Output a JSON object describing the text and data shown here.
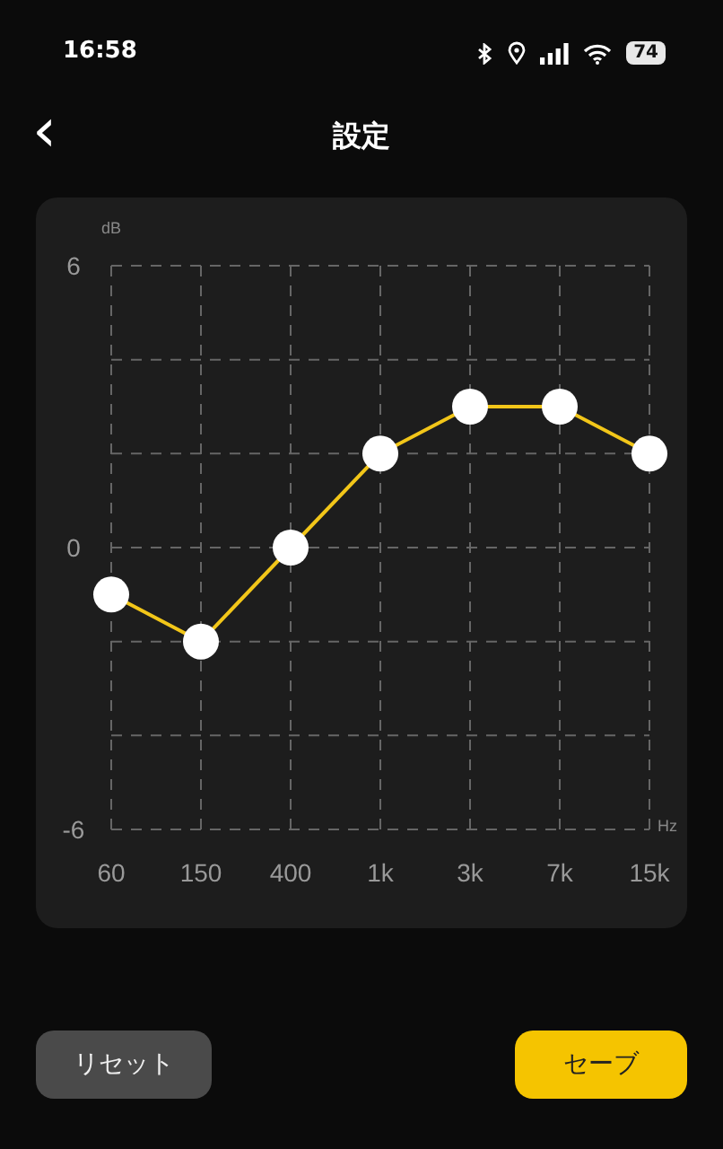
{
  "status_bar": {
    "time": "16:58",
    "battery": "74"
  },
  "header": {
    "back": "‹",
    "title": "設定"
  },
  "equalizer": {
    "chart_data": {
      "type": "line",
      "ylabel": "dB",
      "xlabel": "Hz",
      "categories": [
        "60",
        "150",
        "400",
        "1k",
        "3k",
        "7k",
        "15k"
      ],
      "values": [
        -1,
        -2,
        0,
        2,
        3,
        3,
        2
      ],
      "ylim": [
        -6,
        6
      ],
      "yticks": [
        6,
        0,
        -6
      ],
      "grid": true,
      "marker": "circle"
    }
  },
  "buttons": [
    {
      "label": "リセット",
      "kind": "secondary"
    },
    {
      "label": "セーブ",
      "kind": "primary"
    }
  ]
}
